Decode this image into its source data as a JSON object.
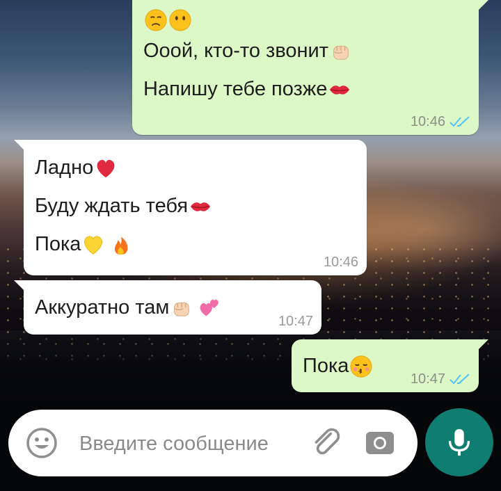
{
  "messages": [
    {
      "direction": "outgoing",
      "lines": [
        {
          "text": "",
          "emojis": [
            "disappointed-face-emoji",
            "face-without-mouth-emoji"
          ]
        },
        {
          "text": "Ооой, кто-то звонит",
          "emojis": [
            "raised-fist-emoji"
          ]
        },
        {
          "text": "Напишу тебе позже",
          "emojis": [
            "kiss-mark-emoji"
          ]
        }
      ],
      "time": "10:46",
      "status": "read"
    },
    {
      "direction": "incoming",
      "lines": [
        {
          "text": "Ладно",
          "emojis": [
            "red-heart-emoji"
          ]
        },
        {
          "text": "Буду ждать тебя",
          "emojis": [
            "kiss-mark-emoji"
          ]
        },
        {
          "text": "Пока",
          "emojis": [
            "yellow-heart-emoji",
            "fire-emoji"
          ]
        }
      ],
      "time": "10:46"
    },
    {
      "direction": "incoming",
      "lines": [
        {
          "text": "Аккуратно там",
          "emojis": [
            "raised-fist-emoji",
            "two-hearts-emoji"
          ]
        }
      ],
      "time": "10:47"
    },
    {
      "direction": "outgoing",
      "lines": [
        {
          "text": "Пока",
          "emojis": [
            "kissing-face-closed-eyes-emoji"
          ]
        }
      ],
      "time": "10:47",
      "status": "read"
    }
  ],
  "composer": {
    "placeholder": "Введите сообщение",
    "emoji_icon": "emoji-face-icon",
    "attach_icon": "paperclip-icon",
    "camera_icon": "camera-icon",
    "mic_icon": "microphone-icon"
  },
  "colors": {
    "outgoing_bubble": "#dcf8c6",
    "incoming_bubble": "#ffffff",
    "read_ticks": "#4fc3f7",
    "send_button": "#0f7d70"
  }
}
